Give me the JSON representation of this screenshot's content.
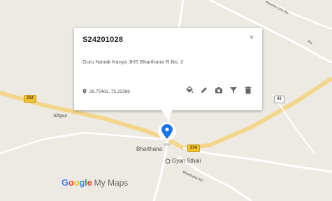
{
  "popup": {
    "title": "S24201028",
    "close_label": "×",
    "description": "Guru Nanak Kanya JHS Bharthana R.No. 2",
    "coordinates": "26.75481, 75.22386",
    "actions": [
      {
        "icon": "paint-bucket-icon"
      },
      {
        "icon": "pencil-icon"
      },
      {
        "icon": "camera-icon"
      },
      {
        "icon": "filter-icon"
      },
      {
        "icon": "trash-icon"
      }
    ]
  },
  "map": {
    "places": [
      {
        "name": "Sihpur"
      },
      {
        "name": "Bharthana"
      },
      {
        "name": "Gyan Sthali"
      }
    ],
    "route_shields": [
      {
        "label": "234"
      },
      {
        "label": "234"
      },
      {
        "label": "43"
      }
    ],
    "road_text": [
      "Bhartha Link Rd",
      "Bharthana Rd",
      "Rd"
    ]
  },
  "watermark": {
    "brand": [
      "G",
      "o",
      "o",
      "g",
      "l",
      "e"
    ],
    "product": "My Maps"
  },
  "colors": {
    "marker": "#1a73e8",
    "road_primary": "#f6d27a",
    "map_background": "#eceae3"
  }
}
